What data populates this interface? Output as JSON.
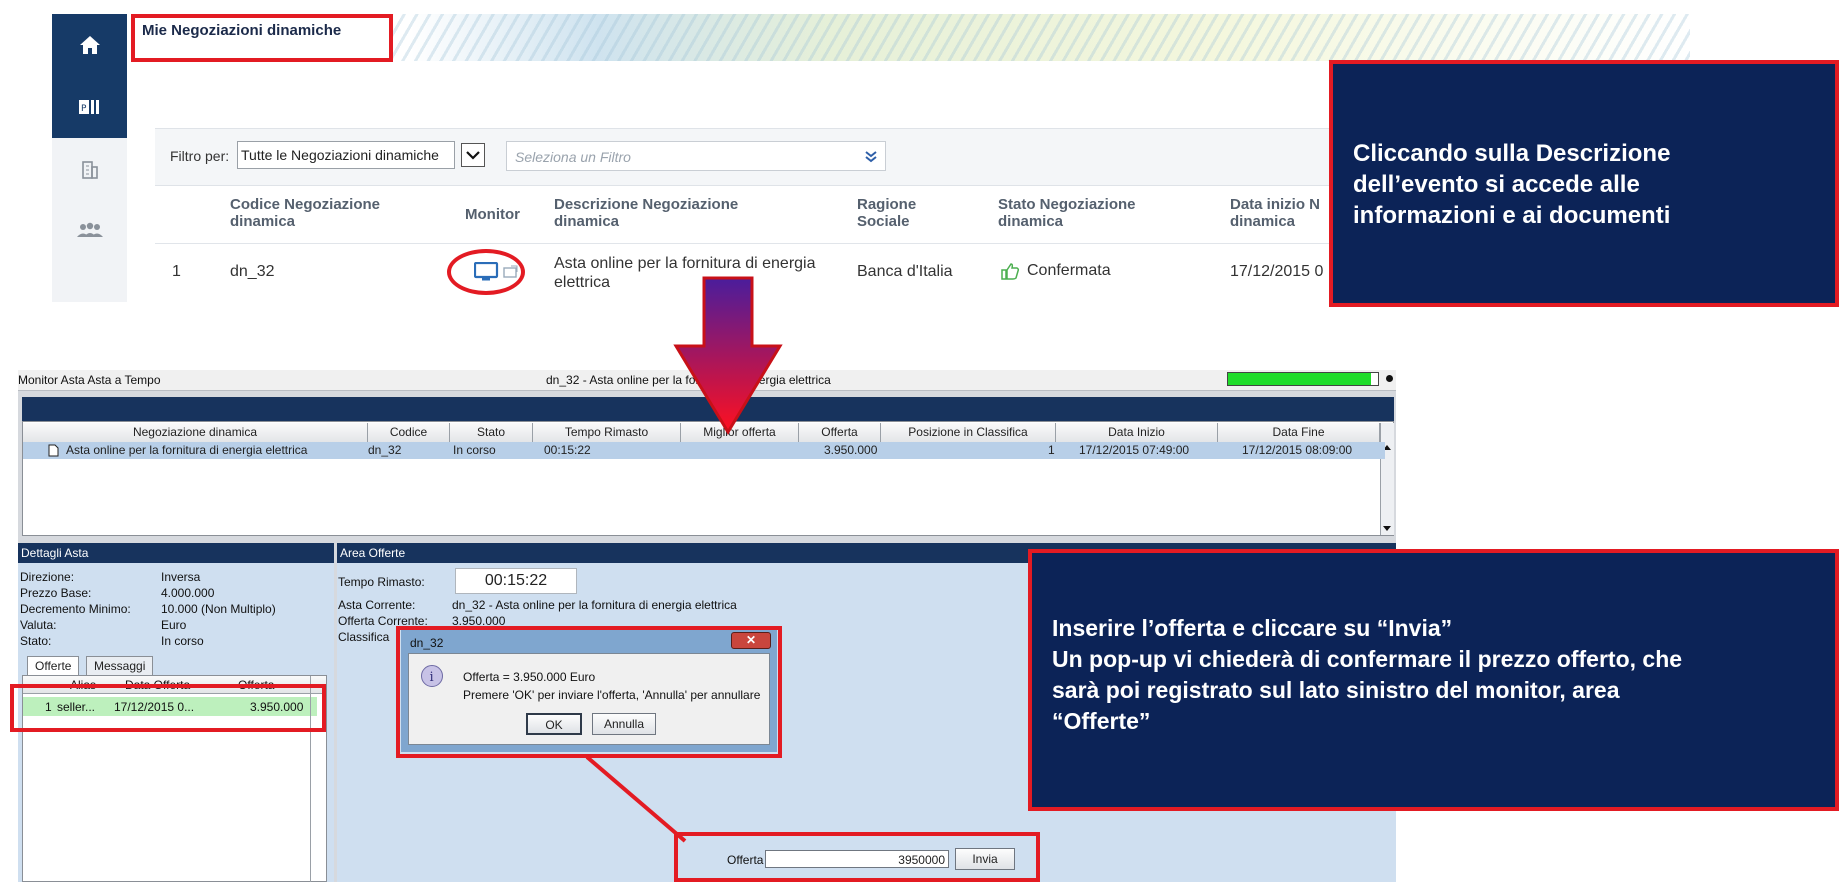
{
  "portal": {
    "page_title": "Mie Negoziazioni dinamiche",
    "filter_label": "Filtro per:",
    "filter_value": "Tutte le Negoziazioni dinamiche",
    "filter_placeholder": "Seleziona un Filtro",
    "columns": {
      "code": "Codice Negoziazione dinamica",
      "monitor": "Monitor",
      "description": "Descrizione Negoziazione dinamica",
      "company": "Ragione Sociale",
      "status": "Stato Negoziazione dinamica",
      "start": "Data inizio N dinamica"
    },
    "row": {
      "index": "1",
      "code": "dn_32",
      "description": "Asta online per la fornitura di energia elettrica",
      "company": "Banca d'Italia",
      "status": "Confermata",
      "start": "17/12/2015 0"
    }
  },
  "callouts": {
    "top": "Cliccando sulla Descrizione\ndell’evento si accede alle\ninformazioni e ai documenti",
    "bottom": "Inserire l’offerta e cliccare su “Invia”\nUn pop-up vi chiederà di confermare il prezzo offerto, che\nsarà poi registrato sul lato sinistro del monitor, area\n“Offerte”"
  },
  "monitor": {
    "window_title_left": "Monitor Asta Asta a Tempo",
    "window_title_center": "dn_32 - Asta online per la fornitura di energia elettrica",
    "progress": 0.95,
    "headers": [
      "Negoziazione dinamica",
      "Codice",
      "Stato",
      "Tempo Rimasto",
      "Miglior offerta",
      "Offerta",
      "Posizione in Classifica",
      "Data Inizio",
      "Data Fine"
    ],
    "row": {
      "name": "Asta online per la fornitura di energia elettrica",
      "code": "dn_32",
      "status": "In corso",
      "time_left": "00:15:22",
      "best_offer": "",
      "offer": "3.950.000",
      "position": "1",
      "start": "17/12/2015 07:49:00",
      "end": "17/12/2015 08:09:00"
    },
    "details": {
      "header": "Dettagli Asta",
      "fields": [
        {
          "label": "Direzione:",
          "value": "Inversa"
        },
        {
          "label": "Prezzo Base:",
          "value": "4.000.000"
        },
        {
          "label": "Decremento Minimo:",
          "value": "10.000 (Non Multiplo)"
        },
        {
          "label": "Valuta:",
          "value": "Euro"
        },
        {
          "label": "Stato:",
          "value": "In corso"
        }
      ],
      "tabs": [
        "Offerte",
        "Messaggi"
      ],
      "offer_columns": [
        "Alias",
        "Data Offerta",
        "Offerta"
      ],
      "offer_row": {
        "idx": "1",
        "alias": "seller...",
        "date": "17/12/2015 0...",
        "amount": "3.950.000"
      }
    },
    "area": {
      "header": "Area Offerte",
      "time_label": "Tempo Rimasto:",
      "time_value": "00:15:22",
      "current_auction_label": "Asta Corrente:",
      "current_auction_value": "dn_32 - Asta online per la fornitura di energia elettrica",
      "current_offer_label": "Offerta Corrente:",
      "current_offer_value": "3.950.000",
      "ranking_label": "Classifica",
      "offer_label": "Offerta",
      "offer_value": "3950000",
      "send_label": "Invia"
    },
    "dialog": {
      "title": "dn_32",
      "line1": "Offerta = 3.950.000 Euro",
      "line2": "Premere 'OK' per inviare l'offerta, 'Annulla' per annullare",
      "ok": "OK",
      "cancel": "Annulla"
    }
  },
  "colors": {
    "accent_red": "#e31b23",
    "navy": "#0c2357",
    "app_navy": "#17335d",
    "progress_green": "#1fdc2a"
  }
}
